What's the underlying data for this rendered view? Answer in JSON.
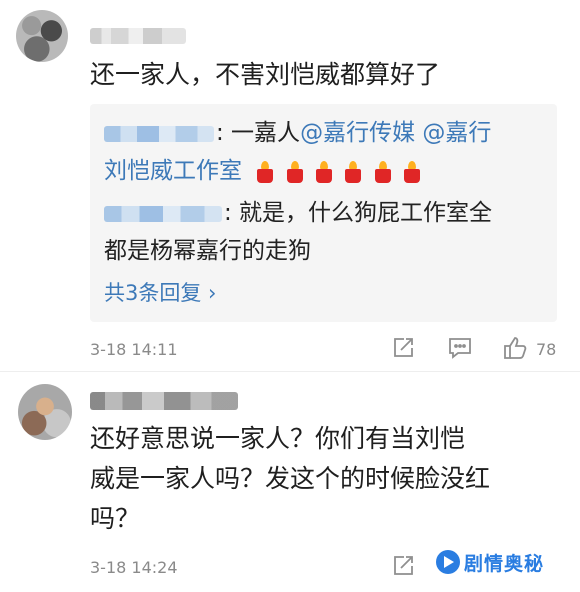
{
  "comment1": {
    "text": "还一家人，不害刘恺威都算好了",
    "replies": [
      {
        "lead": ": 一嘉人",
        "mention1": "@嘉行传媒",
        "mention2": "@嘉行",
        "line2": "刘恺威工作室"
      },
      {
        "lead": ": 就是，什么狗屁工作室全",
        "line2": "都是杨幂嘉行的走狗"
      }
    ],
    "more_replies": "共3条回复 ›",
    "time": "3-18 14:11",
    "like_count": "78"
  },
  "comment2": {
    "lines": [
      "还好意思说一家人？你们有当刘恺",
      "威是一家人吗？发这个的时候脸没红",
      "吗？"
    ],
    "time": "3-18 14:24"
  },
  "watermark": {
    "text": "剧情奥秘"
  },
  "colors": {
    "link": "#3d79b8",
    "reply_bg": "#f5f5f5",
    "watermark": "#2a7de1"
  },
  "icons": [
    "repost-icon",
    "comment-icon",
    "like-icon",
    "candle-emoji"
  ]
}
